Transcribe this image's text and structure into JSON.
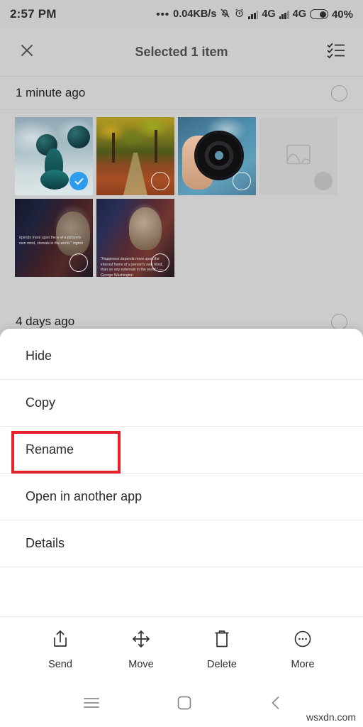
{
  "status_bar": {
    "time": "2:57 PM",
    "dots": "•••",
    "network_speed": "0.04KB/s",
    "icons": [
      "silent-bell-icon",
      "alarm-clock-icon",
      "signal-bars-icon",
      "signal-bars-icon",
      "battery-icon"
    ],
    "sim1_network": "4G",
    "sim2_network": "4G",
    "battery_percent": "40%"
  },
  "app_bar": {
    "close_icon": "close-icon",
    "title": "Selected 1 item",
    "select_all_icon": "checklist-icon"
  },
  "sections": [
    {
      "label": "1 minute ago",
      "select_state": "unselected",
      "photos": [
        {
          "name": "statue-balloons-photo",
          "selected": true,
          "caption": ""
        },
        {
          "name": "autumn-path-photo",
          "selected": false,
          "caption": ""
        },
        {
          "name": "camera-lens-photo",
          "selected": false,
          "caption": ""
        },
        {
          "name": "loading-placeholder",
          "selected": false,
          "caption": ""
        },
        {
          "name": "washington-quote-photo-1",
          "selected": false,
          "caption": "epends more upon the\ne of a person's own mind,\nctemals in the world.\"\n\nington"
        },
        {
          "name": "washington-quote-photo-2",
          "selected": false,
          "caption": "\"Happiness depends more upon the internal frame of\na person's own mind, than on any externals in the world.\"\n— George Washington"
        }
      ]
    },
    {
      "label": "4 days ago",
      "select_state": "unselected",
      "photos": [
        {
          "name": "strawberries-photo",
          "selected": false,
          "caption": ""
        }
      ]
    }
  ],
  "bottom_sheet": {
    "menu_items": [
      {
        "label": "Hide",
        "name": "menu-item-hide",
        "highlighted": false
      },
      {
        "label": "Copy",
        "name": "menu-item-copy",
        "highlighted": false
      },
      {
        "label": "Rename",
        "name": "menu-item-rename",
        "highlighted": true
      },
      {
        "label": "Open in another app",
        "name": "menu-item-open-in-another-app",
        "highlighted": false
      },
      {
        "label": "Details",
        "name": "menu-item-details",
        "highlighted": false
      }
    ],
    "highlight_color": "#e8202a",
    "actions": [
      {
        "label": "Send",
        "icon": "share-icon"
      },
      {
        "label": "Move",
        "icon": "move-arrows-icon"
      },
      {
        "label": "Delete",
        "icon": "trash-icon"
      },
      {
        "label": "More",
        "icon": "more-circle-icon"
      }
    ]
  },
  "nav_bar": {
    "menu_icon": "hamburger-menu-icon",
    "home_icon": "home-square-icon",
    "back_icon": "back-chevron-icon"
  },
  "watermark": "wsxdn.com",
  "colors": {
    "accent_selected": "#2d9cec",
    "highlight": "#e8202a",
    "background": "#cccccc",
    "sheet": "#ffffff"
  }
}
